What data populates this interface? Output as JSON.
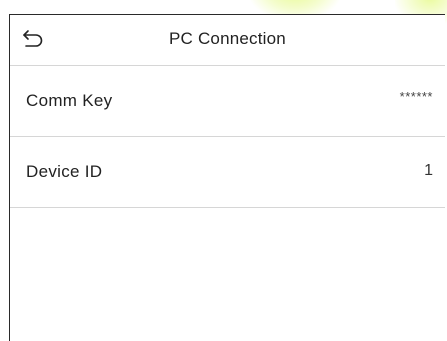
{
  "header": {
    "title": "PC Connection",
    "back_icon": "back-arrow-icon"
  },
  "settings": {
    "items": [
      {
        "label": "Comm Key",
        "value": "******"
      },
      {
        "label": "Device ID",
        "value": "1"
      }
    ]
  },
  "colors": {
    "background": "#ffffff",
    "text": "#222222",
    "divider": "#d6d6d6",
    "accent_glow": "#d5f63c"
  }
}
